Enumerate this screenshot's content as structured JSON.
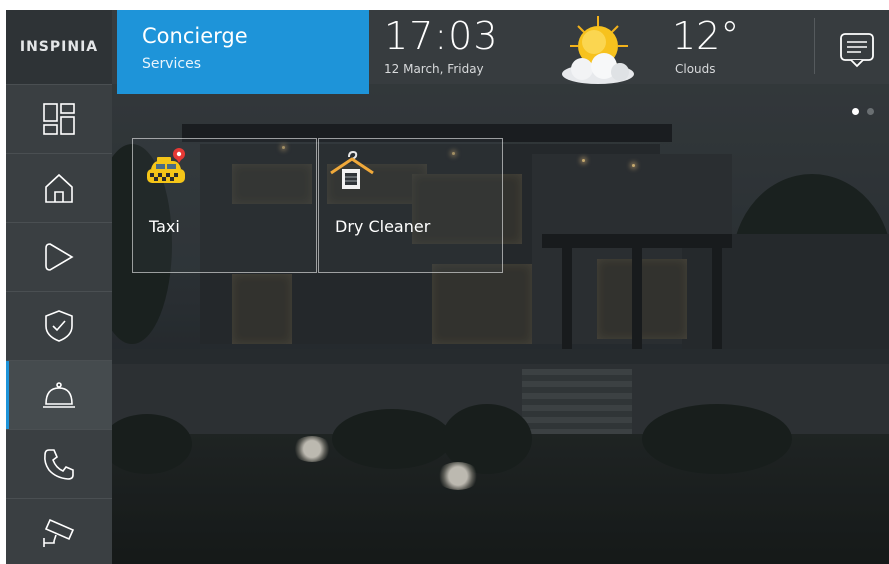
{
  "brand": {
    "logo_text": "INSPINIA"
  },
  "header": {
    "title": "Concierge",
    "subtitle": "Services",
    "time": "17:03",
    "date": "12 March, Friday",
    "temperature": "12°",
    "condition": "Clouds",
    "weather_icon": "sun-behind-cloud-icon",
    "messages_icon": "message-icon"
  },
  "sidebar": {
    "items": [
      {
        "name": "dashboard",
        "icon": "dashboard-icon",
        "active": false
      },
      {
        "name": "home",
        "icon": "home-icon",
        "active": false
      },
      {
        "name": "scenes",
        "icon": "play-icon",
        "active": false
      },
      {
        "name": "security",
        "icon": "shield-icon",
        "active": false
      },
      {
        "name": "concierge",
        "icon": "cloche-icon",
        "active": true
      },
      {
        "name": "phone",
        "icon": "phone-icon",
        "active": false
      },
      {
        "name": "cameras",
        "icon": "camera-icon",
        "active": false
      }
    ]
  },
  "pagination": {
    "pages": 2,
    "current": 1
  },
  "services": [
    {
      "label": "Taxi",
      "icon": "taxi-icon"
    },
    {
      "label": "Dry Cleaner",
      "icon": "dry-cleaner-icon"
    }
  ],
  "colors": {
    "accent": "#1e94d9",
    "sidebar": "#3a3f42",
    "header": "#373c3f"
  }
}
